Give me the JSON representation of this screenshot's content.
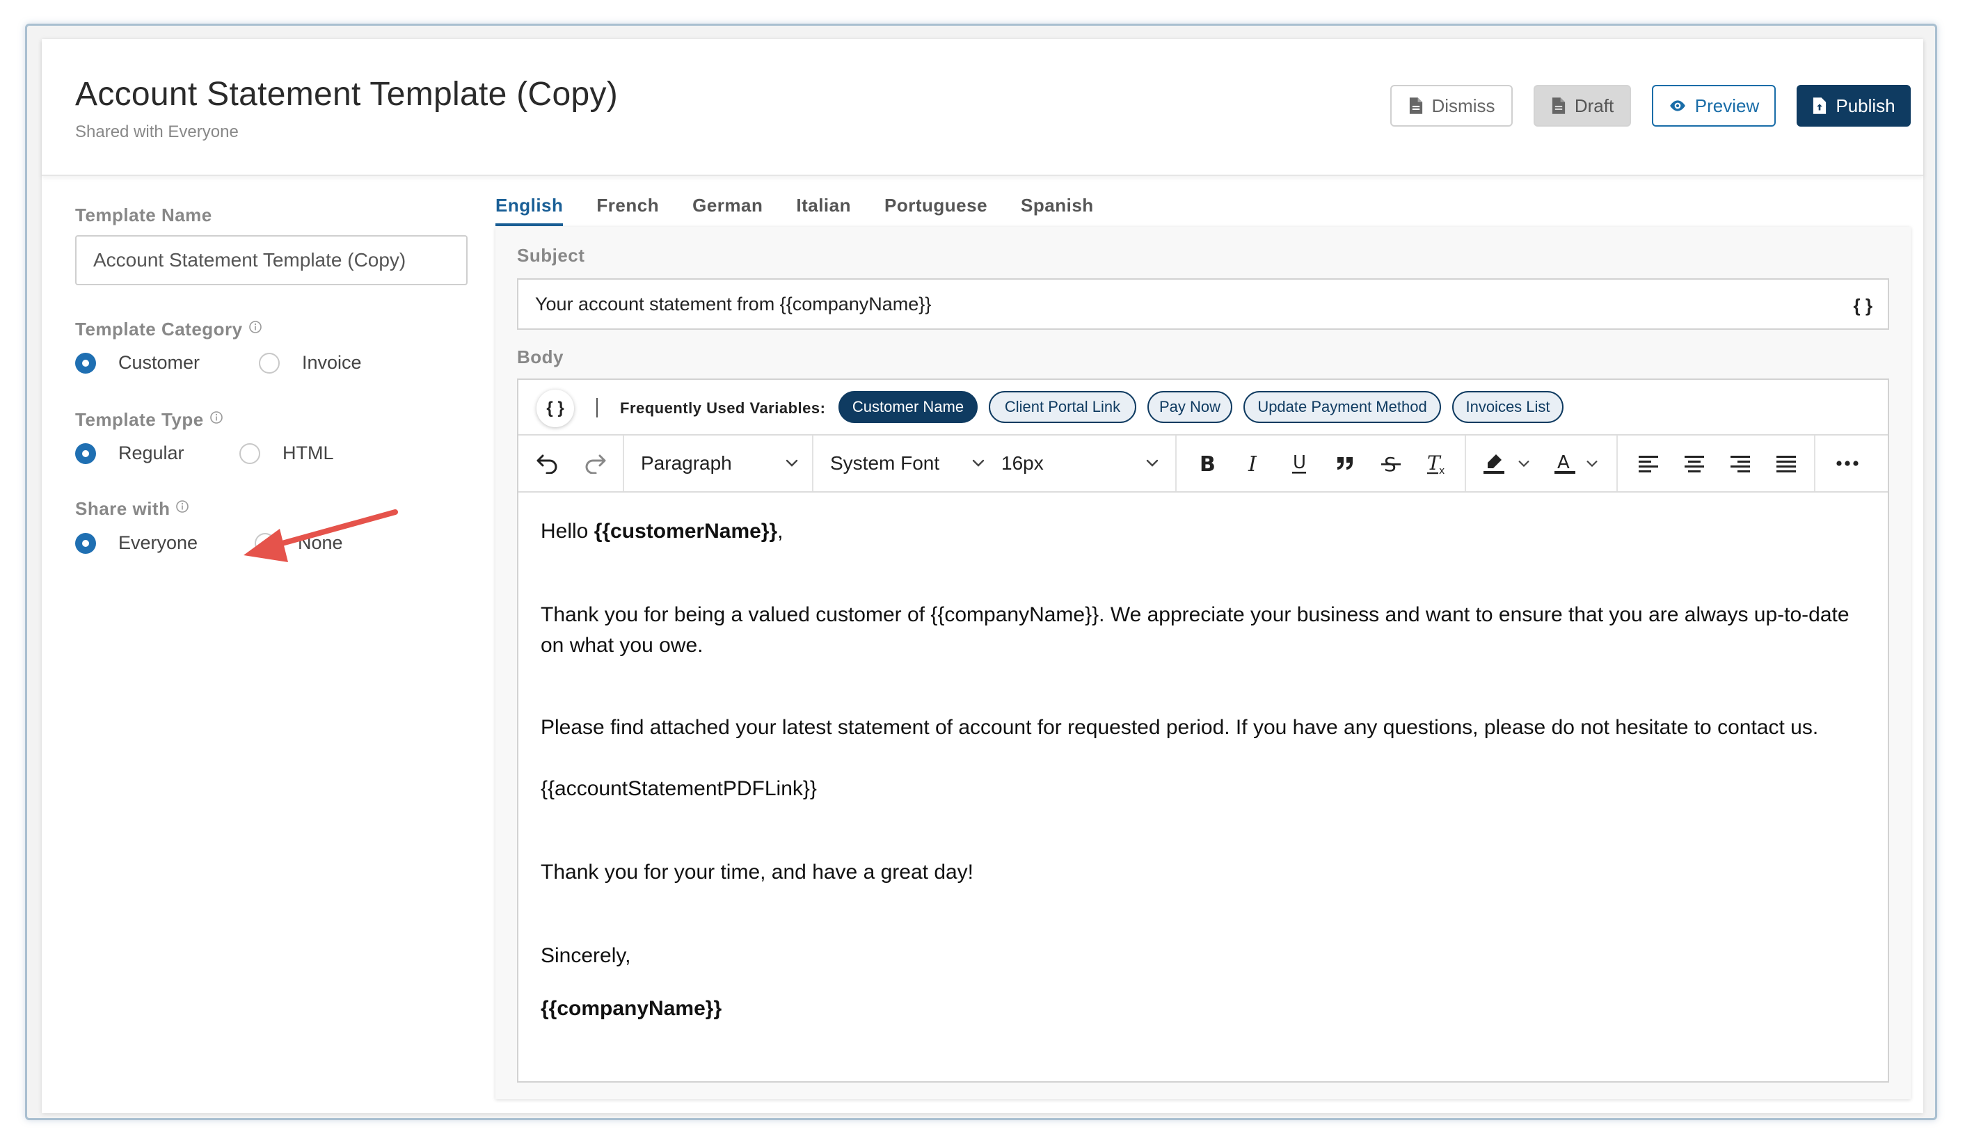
{
  "header": {
    "title": "Account Statement Template (Copy)",
    "subtitle": "Shared with Everyone",
    "buttons": {
      "dismiss": "Dismiss",
      "draft": "Draft",
      "preview": "Preview",
      "publish": "Publish"
    }
  },
  "form": {
    "template_name_label": "Template Name",
    "template_name_value": "Account Statement Template (Copy)",
    "category_label": "Template Category",
    "category_options": [
      "Customer",
      "Invoice"
    ],
    "category_selected": "Customer",
    "type_label": "Template Type",
    "type_options": [
      "Regular",
      "HTML"
    ],
    "type_selected": "Regular",
    "share_label": "Share with",
    "share_options": [
      "Everyone",
      "None"
    ],
    "share_selected": "Everyone"
  },
  "tabs": [
    "English",
    "French",
    "German",
    "Italian",
    "Portuguese",
    "Spanish"
  ],
  "active_tab": "English",
  "editor": {
    "subject_label": "Subject",
    "subject_value": "Your account statement from {{companyName}}",
    "subject_var_button": "{ }",
    "body_label": "Body",
    "var_button": "{ }",
    "frequent_vars_label": "Frequently Used Variables:",
    "frequent_vars": [
      "Customer Name",
      "Client Portal Link",
      "Pay Now",
      "Update Payment Method",
      "Invoices List"
    ],
    "toolbar": {
      "block_format": "Paragraph",
      "font_family": "System Font",
      "font_size": "16px"
    },
    "body": {
      "greeting_prefix": "Hello ",
      "greeting_var": "{{customerName}}",
      "greeting_suffix": ",",
      "para1": "Thank you for being a valued customer of {{companyName}}. We appreciate your business and want to ensure that you are always up-to-date on what you owe.",
      "para2": "Please find attached your latest statement of account for requested period. If you have any questions, please do not hesitate to contact us.",
      "pdf_link": "{{accountStatementPDFLink}}",
      "thanks": "Thank you for your time, and have a great day!",
      "sign_off": "Sincerely,",
      "company": "{{companyName}}"
    }
  },
  "colors": {
    "primary": "#0f3b61",
    "accent": "#1a6da8",
    "radio": "#1f6fb2",
    "annotation_arrow": "#e5534b"
  }
}
